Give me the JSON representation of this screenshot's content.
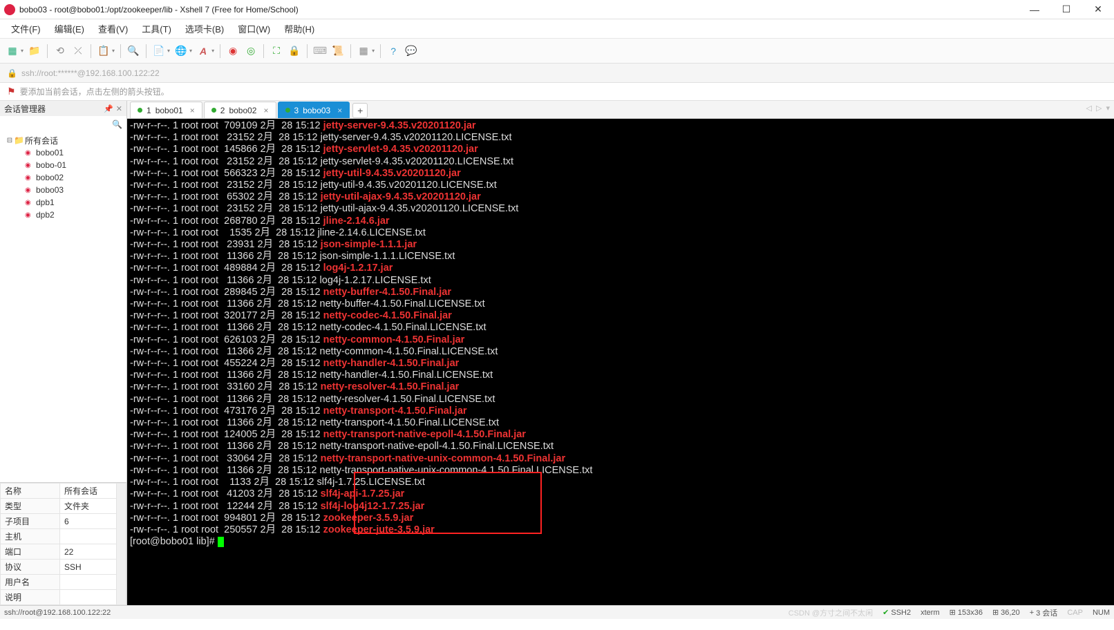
{
  "window": {
    "title": "bobo03 - root@bobo01:/opt/zookeeper/lib - Xshell 7 (Free for Home/School)"
  },
  "menu": [
    "文件(F)",
    "编辑(E)",
    "查看(V)",
    "工具(T)",
    "选项卡(B)",
    "窗口(W)",
    "帮助(H)"
  ],
  "address": "ssh://root:******@192.168.100.122:22",
  "hint": "要添加当前会话，点击左侧的箭头按钮。",
  "sidebar": {
    "title": "会话管理器",
    "root": "所有会话",
    "items": [
      "bobo01",
      "bobo-01",
      "bobo02",
      "bobo03",
      "dpb1",
      "dpb2"
    ]
  },
  "props": {
    "rows": [
      [
        "名称",
        "所有会话"
      ],
      [
        "类型",
        "文件夹"
      ],
      [
        "子项目",
        "6"
      ],
      [
        "主机",
        ""
      ],
      [
        "端口",
        "22"
      ],
      [
        "协议",
        "SSH"
      ],
      [
        "用户名",
        ""
      ],
      [
        "说明",
        ""
      ]
    ]
  },
  "tabs": [
    {
      "num": "1",
      "label": "bobo01",
      "active": false
    },
    {
      "num": "2",
      "label": "bobo02",
      "active": false
    },
    {
      "num": "3",
      "label": "bobo03",
      "active": true
    }
  ],
  "terminal_lines": [
    {
      "perm": "-rw-r--r--. 1 root root  709109 2月  28 15:12 ",
      "file": "jetty-server-9.4.35.v20201120.jar",
      "red": true
    },
    {
      "perm": "-rw-r--r--. 1 root root   23152 2月  28 15:12 ",
      "file": "jetty-server-9.4.35.v20201120.LICENSE.txt",
      "red": false
    },
    {
      "perm": "-rw-r--r--. 1 root root  145866 2月  28 15:12 ",
      "file": "jetty-servlet-9.4.35.v20201120.jar",
      "red": true
    },
    {
      "perm": "-rw-r--r--. 1 root root   23152 2月  28 15:12 ",
      "file": "jetty-servlet-9.4.35.v20201120.LICENSE.txt",
      "red": false
    },
    {
      "perm": "-rw-r--r--. 1 root root  566323 2月  28 15:12 ",
      "file": "jetty-util-9.4.35.v20201120.jar",
      "red": true
    },
    {
      "perm": "-rw-r--r--. 1 root root   23152 2月  28 15:12 ",
      "file": "jetty-util-9.4.35.v20201120.LICENSE.txt",
      "red": false
    },
    {
      "perm": "-rw-r--r--. 1 root root   65302 2月  28 15:12 ",
      "file": "jetty-util-ajax-9.4.35.v20201120.jar",
      "red": true
    },
    {
      "perm": "-rw-r--r--. 1 root root   23152 2月  28 15:12 ",
      "file": "jetty-util-ajax-9.4.35.v20201120.LICENSE.txt",
      "red": false
    },
    {
      "perm": "-rw-r--r--. 1 root root  268780 2月  28 15:12 ",
      "file": "jline-2.14.6.jar",
      "red": true
    },
    {
      "perm": "-rw-r--r--. 1 root root    1535 2月  28 15:12 ",
      "file": "jline-2.14.6.LICENSE.txt",
      "red": false
    },
    {
      "perm": "-rw-r--r--. 1 root root   23931 2月  28 15:12 ",
      "file": "json-simple-1.1.1.jar",
      "red": true
    },
    {
      "perm": "-rw-r--r--. 1 root root   11366 2月  28 15:12 ",
      "file": "json-simple-1.1.1.LICENSE.txt",
      "red": false
    },
    {
      "perm": "-rw-r--r--. 1 root root  489884 2月  28 15:12 ",
      "file": "log4j-1.2.17.jar",
      "red": true
    },
    {
      "perm": "-rw-r--r--. 1 root root   11366 2月  28 15:12 ",
      "file": "log4j-1.2.17.LICENSE.txt",
      "red": false
    },
    {
      "perm": "-rw-r--r--. 1 root root  289845 2月  28 15:12 ",
      "file": "netty-buffer-4.1.50.Final.jar",
      "red": true
    },
    {
      "perm": "-rw-r--r--. 1 root root   11366 2月  28 15:12 ",
      "file": "netty-buffer-4.1.50.Final.LICENSE.txt",
      "red": false
    },
    {
      "perm": "-rw-r--r--. 1 root root  320177 2月  28 15:12 ",
      "file": "netty-codec-4.1.50.Final.jar",
      "red": true
    },
    {
      "perm": "-rw-r--r--. 1 root root   11366 2月  28 15:12 ",
      "file": "netty-codec-4.1.50.Final.LICENSE.txt",
      "red": false
    },
    {
      "perm": "-rw-r--r--. 1 root root  626103 2月  28 15:12 ",
      "file": "netty-common-4.1.50.Final.jar",
      "red": true
    },
    {
      "perm": "-rw-r--r--. 1 root root   11366 2月  28 15:12 ",
      "file": "netty-common-4.1.50.Final.LICENSE.txt",
      "red": false
    },
    {
      "perm": "-rw-r--r--. 1 root root  455224 2月  28 15:12 ",
      "file": "netty-handler-4.1.50.Final.jar",
      "red": true
    },
    {
      "perm": "-rw-r--r--. 1 root root   11366 2月  28 15:12 ",
      "file": "netty-handler-4.1.50.Final.LICENSE.txt",
      "red": false
    },
    {
      "perm": "-rw-r--r--. 1 root root   33160 2月  28 15:12 ",
      "file": "netty-resolver-4.1.50.Final.jar",
      "red": true
    },
    {
      "perm": "-rw-r--r--. 1 root root   11366 2月  28 15:12 ",
      "file": "netty-resolver-4.1.50.Final.LICENSE.txt",
      "red": false
    },
    {
      "perm": "-rw-r--r--. 1 root root  473176 2月  28 15:12 ",
      "file": "netty-transport-4.1.50.Final.jar",
      "red": true
    },
    {
      "perm": "-rw-r--r--. 1 root root   11366 2月  28 15:12 ",
      "file": "netty-transport-4.1.50.Final.LICENSE.txt",
      "red": false
    },
    {
      "perm": "-rw-r--r--. 1 root root  124005 2月  28 15:12 ",
      "file": "netty-transport-native-epoll-4.1.50.Final.jar",
      "red": true
    },
    {
      "perm": "-rw-r--r--. 1 root root   11366 2月  28 15:12 ",
      "file": "netty-transport-native-epoll-4.1.50.Final.LICENSE.txt",
      "red": false
    },
    {
      "perm": "-rw-r--r--. 1 root root   33064 2月  28 15:12 ",
      "file": "netty-transport-native-unix-common-4.1.50.Final.jar",
      "red": true
    },
    {
      "perm": "-rw-r--r--. 1 root root   11366 2月  28 15:12 ",
      "file": "netty-transport-native-unix-common-4.1.50.Final.LICENSE.txt",
      "red": false
    },
    {
      "perm": "-rw-r--r--. 1 root root    1133 2月  28 15:12 ",
      "file": "slf4j-1.7.25.LICENSE.txt",
      "red": false
    },
    {
      "perm": "-rw-r--r--. 1 root root   41203 2月  28 15:12 ",
      "file": "slf4j-api-1.7.25.jar",
      "red": true
    },
    {
      "perm": "-rw-r--r--. 1 root root   12244 2月  28 15:12 ",
      "file": "slf4j-log4j12-1.7.25.jar",
      "red": true
    },
    {
      "perm": "-rw-r--r--. 1 root root  994801 2月  28 15:12 ",
      "file": "zookeeper-3.5.9.jar",
      "red": true
    },
    {
      "perm": "-rw-r--r--. 1 root root  250557 2月  28 15:12 ",
      "file": "zookeeper-jute-3.5.9.jar",
      "red": true
    }
  ],
  "prompt": "[root@bobo01 lib]# ",
  "status": {
    "left": "ssh://root@192.168.100.122:22",
    "watermark": "CSDN @方寸之间不太闲",
    "items": [
      "SSH2",
      "xterm",
      "153x36",
      "36,20",
      "3 会话",
      "CAP",
      "NUM"
    ]
  }
}
